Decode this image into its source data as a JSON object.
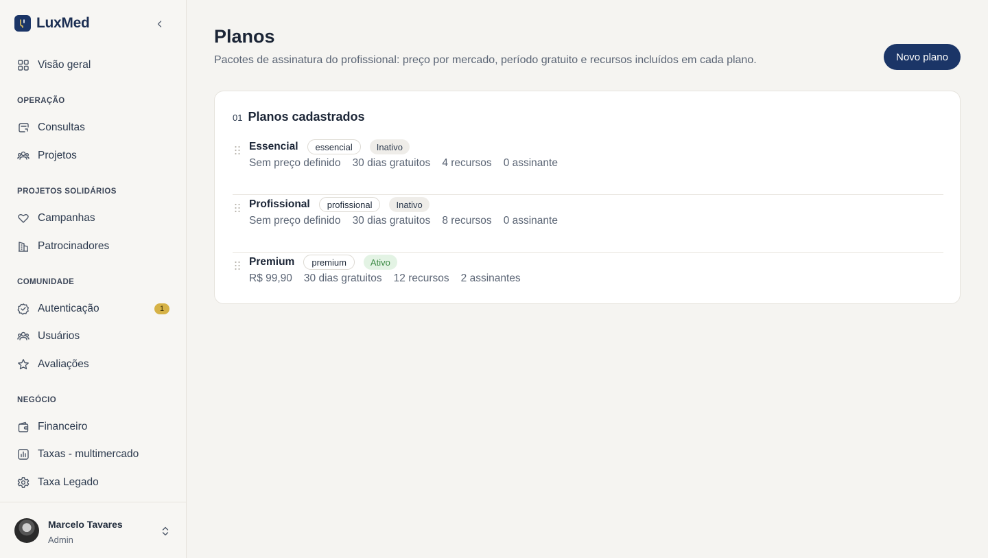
{
  "brand": {
    "name": "LuxMed"
  },
  "sidebar": {
    "items": [
      {
        "label": "Visão geral",
        "icon": "grid-icon"
      }
    ],
    "sections": [
      {
        "title": "OPERAÇÃO",
        "items": [
          {
            "label": "Consultas",
            "icon": "consultations-icon"
          },
          {
            "label": "Projetos",
            "icon": "users-icon"
          }
        ]
      },
      {
        "title": "PROJETOS SOLIDÁRIOS",
        "items": [
          {
            "label": "Campanhas",
            "icon": "heart-icon"
          },
          {
            "label": "Patrocinadores",
            "icon": "building-icon"
          }
        ]
      },
      {
        "title": "COMUNIDADE",
        "items": [
          {
            "label": "Autenticação",
            "icon": "badge-check-icon",
            "badge": "1"
          },
          {
            "label": "Usuários",
            "icon": "users-icon"
          },
          {
            "label": "Avaliações",
            "icon": "star-icon"
          }
        ]
      },
      {
        "title": "NEGÓCIO",
        "items": [
          {
            "label": "Financeiro",
            "icon": "wallet-icon"
          },
          {
            "label": "Taxas - multimercado",
            "icon": "bar-chart-icon"
          },
          {
            "label": "Taxa Legado",
            "icon": "gear-icon"
          }
        ]
      }
    ]
  },
  "user": {
    "name": "Marcelo Tavares",
    "role": "Admin"
  },
  "header": {
    "title": "Planos",
    "subtitle": "Pacotes de assinatura do profissional: preço por mercado, período gratuito e recursos incluídos em cada plano.",
    "new_plan_label": "Novo plano"
  },
  "card": {
    "index": "01",
    "title": "Planos cadastrados",
    "plans": [
      {
        "name": "Essencial",
        "slug": "essencial",
        "status": "Inativo",
        "active": false,
        "price": "Sem preço definido",
        "trial": "30 dias gratuitos",
        "features": "4 recursos",
        "subscribers": "0 assinante"
      },
      {
        "name": "Profissional",
        "slug": "profissional",
        "status": "Inativo",
        "active": false,
        "price": "Sem preço definido",
        "trial": "30 dias gratuitos",
        "features": "8 recursos",
        "subscribers": "0 assinante"
      },
      {
        "name": "Premium",
        "slug": "premium",
        "status": "Ativo",
        "active": true,
        "price": "R$ 99,90",
        "trial": "30 dias gratuitos",
        "features": "12 recursos",
        "subscribers": "2 assinantes"
      }
    ]
  },
  "colors": {
    "brand_navy": "#1b3567",
    "badge_gold": "#d6b246",
    "active_green": "#3b8a44",
    "background": "#f5f4f1"
  }
}
